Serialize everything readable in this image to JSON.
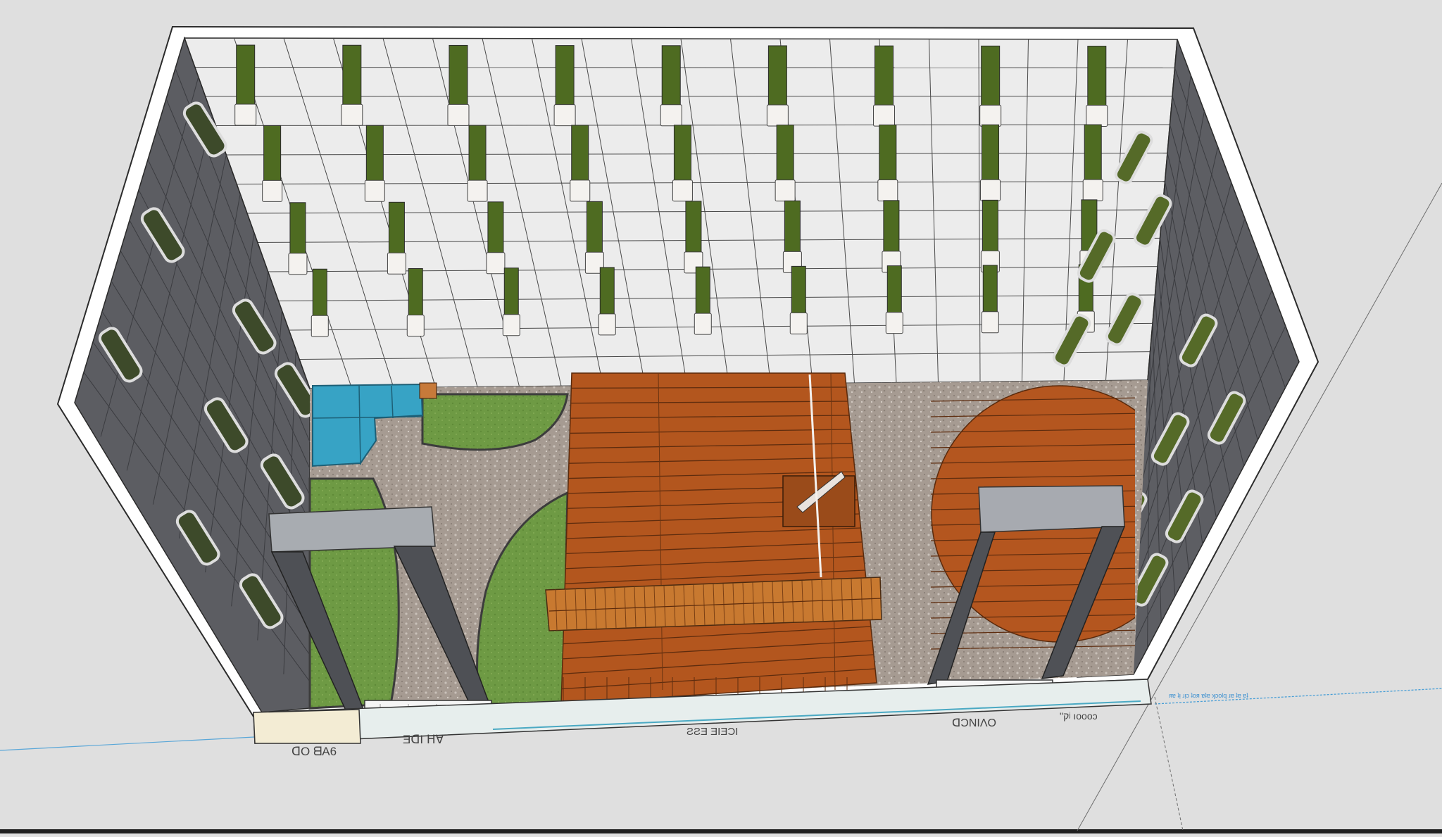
{
  "scene": {
    "background_color": "#dfdfdf",
    "palette": {
      "facade_light": "#ebebeb",
      "facade_dark": "#5d5e63",
      "planter_green": "#4f6b22",
      "lawn": "#6f9a45",
      "gravel": "#a59a91",
      "deck": "#b4561f",
      "water": "#3aa4c6",
      "frame_top": "#a9adb3",
      "frame_post": "#505257",
      "guide_line": "#4a9fd6"
    },
    "labels": {
      "bottom_left_1": "ᗡO ᗺA6",
      "bottom_left_2": "ƎᗡI ᕼ∀",
      "bottom_center": "ƧƧƎ ƎIƎƆI",
      "bottom_right_1": "ᗡƆNIΛO",
      "bottom_right_2": "ʺקʲ ıoooɔ",
      "guide_text": "ᴙɐ ʇᴉ ɹᴉɔ ʇoᴙ ɐʇɐ ʞɔolq ɹɐ ʇɐ ɐʇ"
    }
  }
}
